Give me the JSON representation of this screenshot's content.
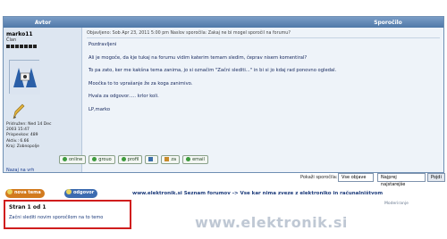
{
  "header": {
    "author_col": "Avtor",
    "message_col": "Sporočilo"
  },
  "user": {
    "name": "marko11",
    "role": "Član",
    "info_lines": [
      "Pridružen: Ned 14 Dec",
      "2003 15:47",
      "Prispevkov: 489",
      "Aktiv.: 6.66",
      "Kraj: Zobnopolje"
    ],
    "back_to_top": "Nazaj na vrh"
  },
  "post": {
    "header": "Objavljeno: Sob Apr 23, 2011 5:00 pm     Naslov sporočila:  Zakaj ne bi mogel sporočil na forumu?",
    "paragraphs": [
      "Pozdravljeni",
      "Ali je mogoče, da kje tukaj na forumu vidim katerim temam sledim, čeprav nisem komentiral?",
      "To pa zato, ker me kakšna tema zanima, jo si označim \"Začni slediti...\" in bi si jo kdaj rad ponovno ogledal.",
      "Moočka to to vprašanje že za koga zanimivo.",
      "Hvala za odgovor..... krlor koli.",
      "LP,marko"
    ],
    "buttons": [
      "online",
      "grouo",
      "profil",
      "",
      "za",
      "email"
    ]
  },
  "sort": {
    "label": "Pokaži sporočila:",
    "range_value": "Vse objave",
    "order_value": "Najprej najstarejše",
    "go_label": "Pojdi"
  },
  "nav": {
    "new_topic": "nova tema",
    "reply": "odgovor",
    "breadcrumb": "www.elektronik.si Seznam forumov  ->  Vse kar nima zveze z elektroniko in računalništvom",
    "moderate": "Moderiranje"
  },
  "pagination": {
    "pages_text": "Stran 1 od 1",
    "unwatch_link": "Začni slediti novim sporočilom na to temo"
  },
  "watermark": "www.elektronik.si",
  "colors": {
    "header_blue": "#4f78a8",
    "highlight_red": "#d01d1d",
    "pill_orange": "#d27a1e",
    "pill_blue": "#3c6bb0"
  }
}
